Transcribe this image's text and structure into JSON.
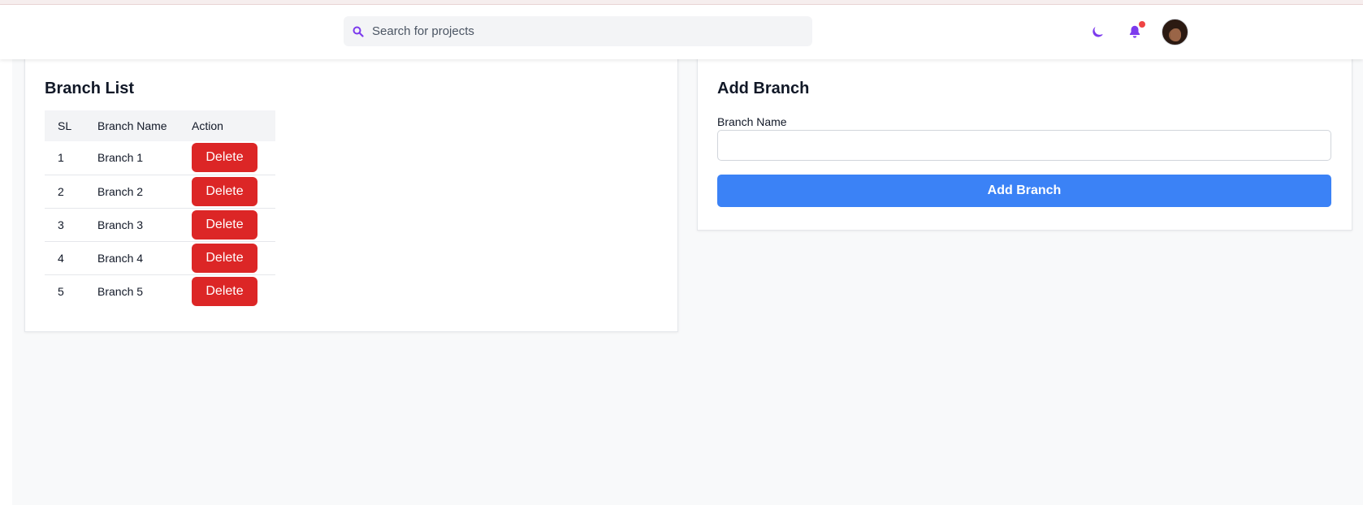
{
  "header": {
    "search": {
      "placeholder": "Search for projects",
      "value": "",
      "icon": "search-icon"
    },
    "icons": {
      "theme": "moon-icon",
      "notifications": "bell-icon",
      "avatar": "user-avatar"
    },
    "colors": {
      "icon_accent": "#7c3aed",
      "notification_dot": "#ef4444"
    }
  },
  "branch_list": {
    "title": "Branch List",
    "columns": [
      "SL",
      "Branch Name",
      "Action"
    ],
    "rows": [
      {
        "sl": "1",
        "name": "Branch 1",
        "action": "Delete"
      },
      {
        "sl": "2",
        "name": "Branch 2",
        "action": "Delete"
      },
      {
        "sl": "3",
        "name": "Branch 3",
        "action": "Delete"
      },
      {
        "sl": "4",
        "name": "Branch 4",
        "action": "Delete"
      },
      {
        "sl": "5",
        "name": "Branch 5",
        "action": "Delete"
      }
    ],
    "delete_color": "#dc2626"
  },
  "add_branch": {
    "title": "Add Branch",
    "field_label": "Branch Name",
    "field_value": "",
    "submit_label": "Add Branch",
    "submit_color": "#3b82f6"
  }
}
